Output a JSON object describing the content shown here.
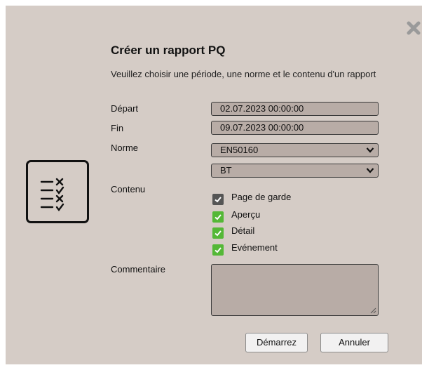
{
  "dialog": {
    "title": "Créer un rapport PQ",
    "subtitle": "Veuillez choisir une période, une norme et le contenu d'un rapport",
    "close_icon": "close-x-icon",
    "report_icon": "checklist-report-icon"
  },
  "form": {
    "start_label": "Départ",
    "start_value": "02.07.2023 00:00:00",
    "end_label": "Fin",
    "end_value": "09.07.2023 00:00:00",
    "norm_label": "Norme",
    "norm_value": "EN50160",
    "voltage_value": "BT",
    "content_label": "Contenu",
    "content_items": [
      {
        "label": "Page de garde",
        "checked": true,
        "color": "#555555"
      },
      {
        "label": "Aperçu",
        "checked": true,
        "color": "#54b837"
      },
      {
        "label": "Détail",
        "checked": true,
        "color": "#54b837"
      },
      {
        "label": "Evénement",
        "checked": true,
        "color": "#54b837"
      }
    ],
    "comment_label": "Commentaire",
    "comment_value": ""
  },
  "buttons": {
    "start": "Démarrez",
    "cancel": "Annuler"
  },
  "colors": {
    "dialog_bg": "#d5ccc6",
    "field_bg": "#b8aca6",
    "checkbox_green": "#54b837",
    "checkbox_dark": "#555555"
  }
}
